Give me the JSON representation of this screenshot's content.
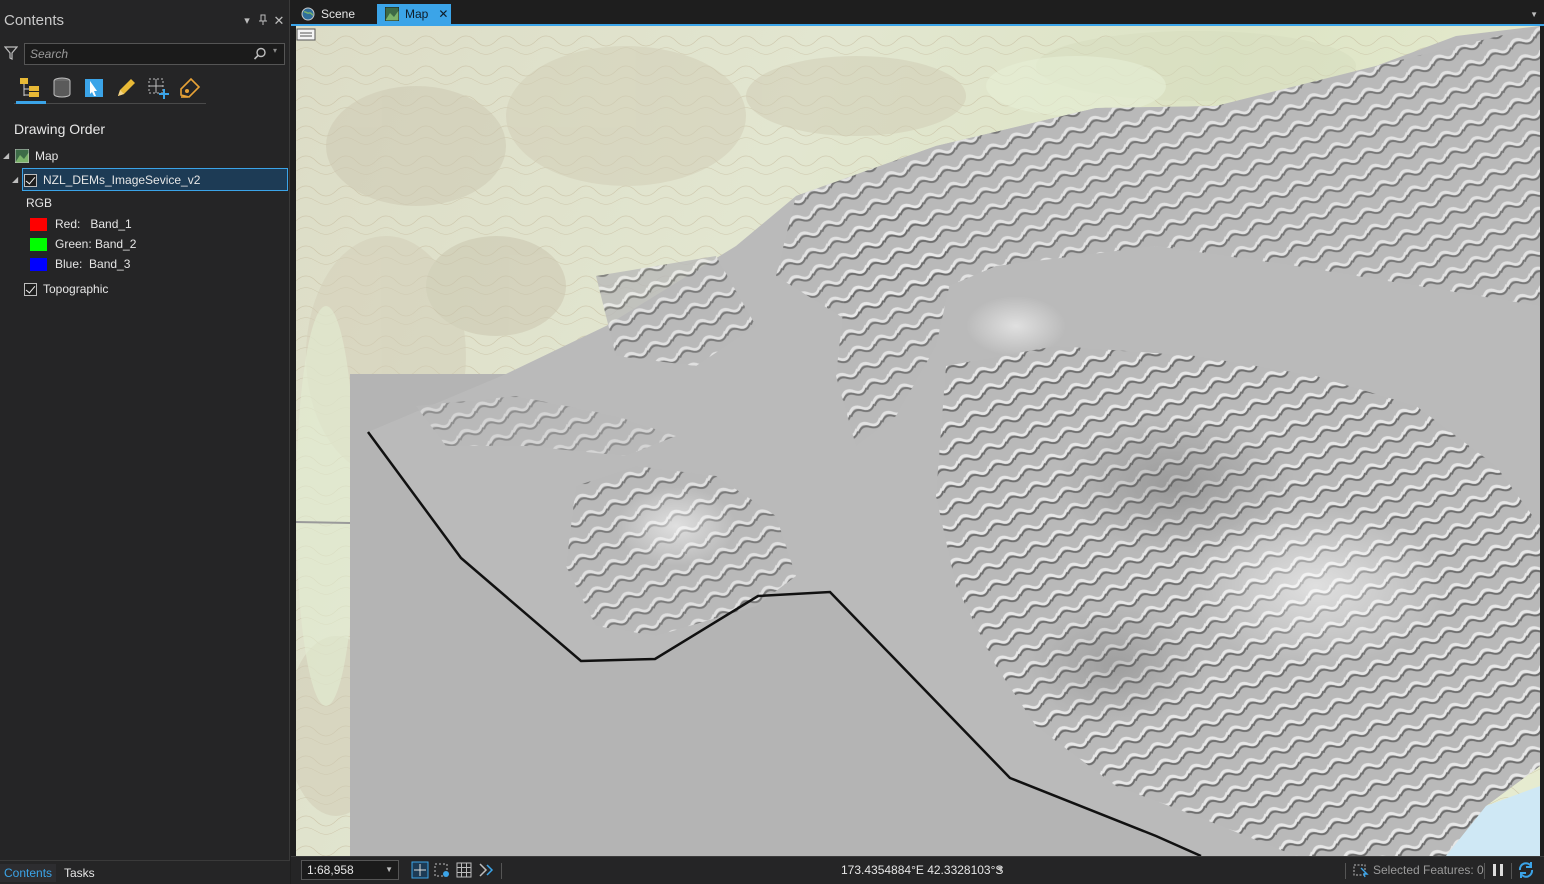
{
  "contents": {
    "title": "Contents",
    "search_placeholder": "Search",
    "section_title": "Drawing Order",
    "map_name": "Map",
    "layer_name": "NZL_DEMs_ImageSevice_v2",
    "renderer": "RGB",
    "bands": [
      {
        "label": "Red:   Band_1",
        "color": "#ff0000"
      },
      {
        "label": "Green: Band_2",
        "color": "#00ff00"
      },
      {
        "label": "Blue:  Band_3",
        "color": "#0000ff"
      }
    ],
    "basemap_name": "Topographic",
    "bottom_tabs": [
      "Contents",
      "Tasks"
    ]
  },
  "view_tabs": [
    {
      "label": "Scene",
      "active": false
    },
    {
      "label": "Map",
      "active": true
    }
  ],
  "status": {
    "scale": "1:68,958",
    "coordinates": "173.4354884°E 42.3328103°S",
    "selected_features": "Selected Features: 0"
  },
  "colors": {
    "accent": "#3ba4e8",
    "panel_bg": "#252526",
    "dem_gray": "#b9b9b9",
    "topo_base": "#dfe3d2",
    "water": "#cfe8f5"
  }
}
